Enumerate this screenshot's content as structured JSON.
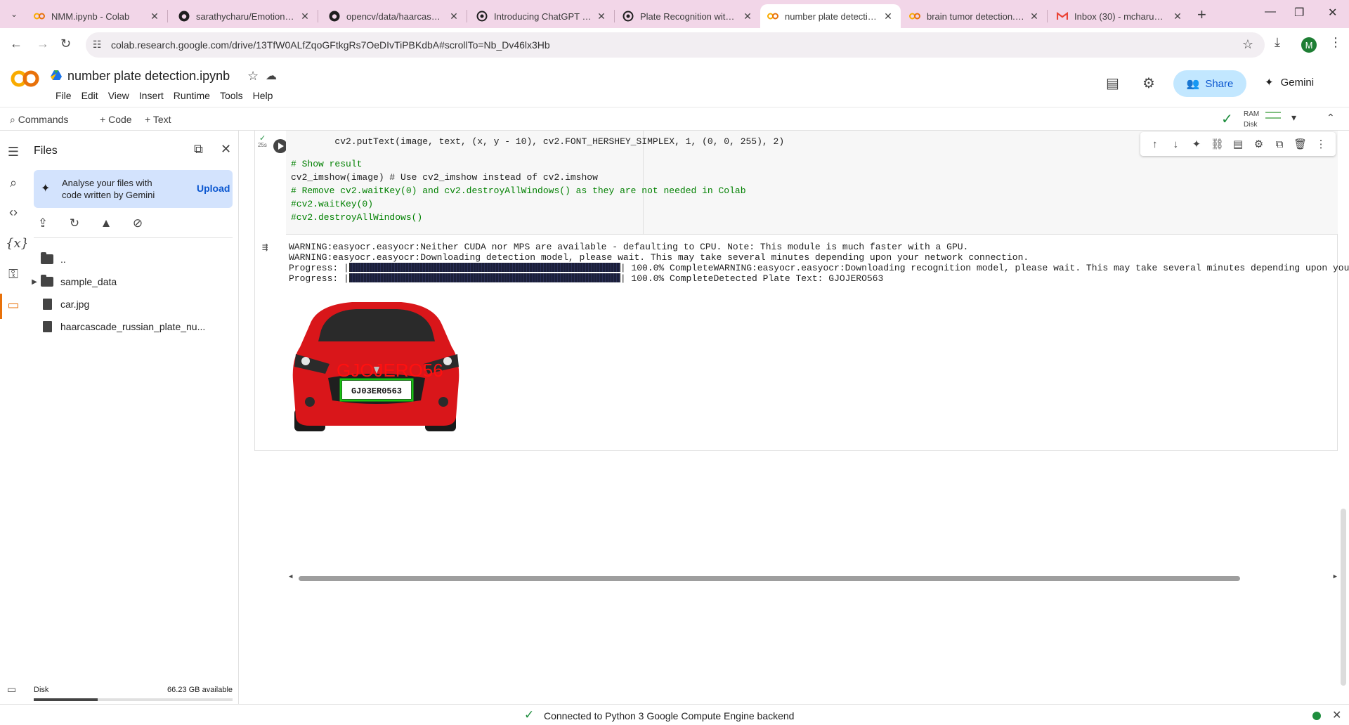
{
  "browser": {
    "tabs": [
      {
        "title": "NMM.ipynb - Colab",
        "icon": "colab-icon"
      },
      {
        "title": "sarathycharu/Emotion-de",
        "icon": "github-icon"
      },
      {
        "title": "opencv/data/haarcascade",
        "icon": "github-icon"
      },
      {
        "title": "Introducing ChatGPT | Op",
        "icon": "openai-icon"
      },
      {
        "title": "Plate Recognition with OC",
        "icon": "openai-icon"
      },
      {
        "title": "number plate detection.ip",
        "icon": "colab-icon"
      },
      {
        "title": "brain tumor detection.ipy",
        "icon": "colab-icon"
      },
      {
        "title": "Inbox (30) - mcharu22sar",
        "icon": "gmail-icon"
      }
    ],
    "url": "colab.research.google.com/drive/13TfW0ALfZqoGFtkgRs7OeDIvTiPBKdbA#scrollTo=Nb_Dv46lx3Hb",
    "profile_initial": "M"
  },
  "colab": {
    "notebook_title": "number plate detection.ipynb",
    "menu": [
      "File",
      "Edit",
      "View",
      "Insert",
      "Runtime",
      "Tools",
      "Help"
    ],
    "share_label": "Share",
    "gemini_label": "Gemini",
    "commands_label": "Commands",
    "code_label": "Code",
    "text_label": "Text",
    "ram_label": "RAM",
    "disk_label": "Disk"
  },
  "files_panel": {
    "title": "Files",
    "gemini_prompt": "Analyse your files with code written by Gemini",
    "upload_label": "Upload",
    "entries": [
      {
        "name": "..",
        "type": "folder"
      },
      {
        "name": "sample_data",
        "type": "folder"
      },
      {
        "name": "car.jpg",
        "type": "file"
      },
      {
        "name": "haarcascade_russian_plate_nu...",
        "type": "file"
      }
    ],
    "disk_label": "Disk",
    "disk_available": "66.23 GB available",
    "disk_used_fraction": 0.32
  },
  "cell": {
    "exec_time": "25s",
    "code_lines": [
      "        cv2.putText(image, text, (x, y - 10), cv2.FONT_HERSHEY_SIMPLEX, 1, (0, 0, 255), 2)",
      "",
      "# Show result",
      "cv2_imshow(image) # Use cv2_imshow instead of cv2.imshow",
      "# Remove cv2.waitKey(0) and cv2.destroyAllWindows() as they are not needed in Colab",
      "#cv2.waitKey(0)",
      "#cv2.destroyAllWindows()"
    ],
    "output_lines": [
      "WARNING:easyocr.easyocr:Neither CUDA nor MPS are available - defaulting to CPU. Note: This module is much faster with a GPU.",
      "WARNING:easyocr.easyocr:Downloading detection model, please wait. This may take several minutes depending upon your network connection."
    ],
    "progress1_prefix": "Progress: |",
    "progress1_suffix": "| 100.0% CompleteWARNING:easyocr.easyocr:Downloading recognition model, please wait. This may take several minutes depending upon you",
    "progress2_prefix": "Progress: |",
    "progress2_suffix": "| 100.0% CompleteDetected Plate Text: GJOJERO563",
    "image_overlay_text": "GJOJERO56",
    "image_plate_text": "GJ03ER0563"
  },
  "status": {
    "text": "Connected to Python 3 Google Compute Engine backend"
  }
}
